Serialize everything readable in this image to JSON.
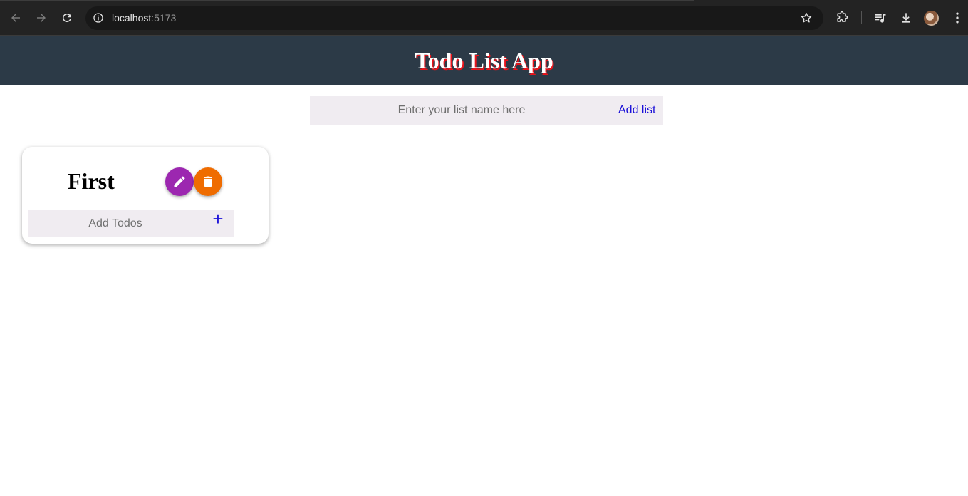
{
  "browser": {
    "url_host": "localhost",
    "url_port": ":5173"
  },
  "app": {
    "title": "Todo List App"
  },
  "add_list": {
    "placeholder": "Enter your list name here",
    "button_label": "Add list"
  },
  "lists": [
    {
      "title": "First",
      "todo_placeholder": "Add Todos",
      "add_todo_label": "+"
    }
  ],
  "colors": {
    "header_bg": "#2c3a47",
    "title_shadow": "#e8141b",
    "edit_fab": "#9c27b0",
    "delete_fab": "#ef6c00",
    "link_blue": "#1a10d8",
    "input_bg": "#f0ecf1"
  },
  "icons": {
    "back": "arrow-left-icon",
    "forward": "arrow-right-icon",
    "reload": "reload-icon",
    "site_info": "info-icon",
    "bookmark": "star-icon",
    "extensions": "puzzle-icon",
    "media": "playlist-icon",
    "downloads": "download-icon",
    "menu": "kebab-menu-icon",
    "edit": "pencil-icon",
    "delete": "trash-icon"
  }
}
